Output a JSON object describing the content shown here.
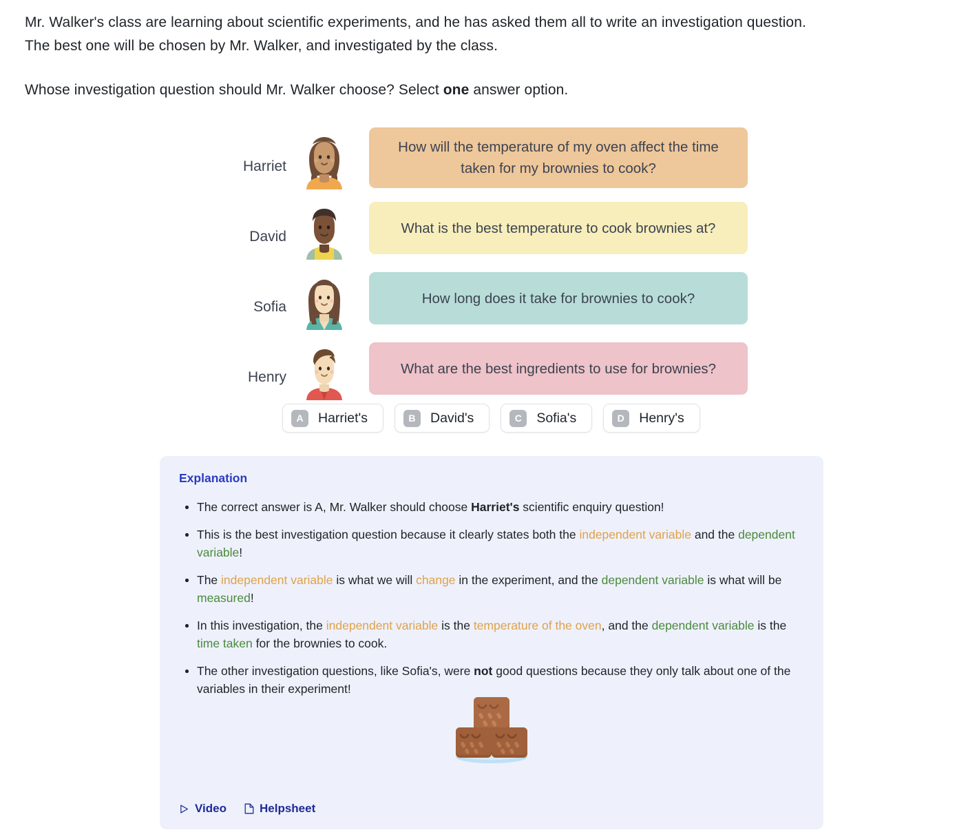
{
  "prompt": {
    "line1": "Mr. Walker's class are learning about scientific experiments, and he has asked them all to write an investigation question.",
    "line2": "The best one will be chosen by Mr. Walker, and investigated by the class.",
    "line3_before": "Whose investigation question should Mr. Walker choose? Select ",
    "line3_bold": "one",
    "line3_after": " answer option."
  },
  "students": [
    {
      "name": "Harriet",
      "question": "How will the temperature of my oven affect the time taken for my brownies to cook?",
      "bubble_color": "#eec79a",
      "avatar": "harriet-avatar"
    },
    {
      "name": "David",
      "question": "What is the best temperature to cook brownies at?",
      "bubble_color": "#f8eebc",
      "avatar": "david-avatar"
    },
    {
      "name": "Sofia",
      "question": "How long does it take for brownies to cook?",
      "bubble_color": "#b8ddd8",
      "avatar": "sofia-avatar"
    },
    {
      "name": "Henry",
      "question": "What are the best ingredients to use for brownies?",
      "bubble_color": "#eec3c9",
      "avatar": "henry-avatar"
    }
  ],
  "options": [
    {
      "letter": "A",
      "label": "Harriet's"
    },
    {
      "letter": "B",
      "label": "David's"
    },
    {
      "letter": "C",
      "label": "Sofia's"
    },
    {
      "letter": "D",
      "label": "Henry's"
    }
  ],
  "explanation": {
    "title": "Explanation",
    "bullets": [
      {
        "parts": [
          {
            "t": "The correct answer is A, Mr. Walker should choose ",
            "s": "plain"
          },
          {
            "t": "Harriet's",
            "s": "bold"
          },
          {
            "t": " scientific enquiry question!",
            "s": "plain"
          }
        ]
      },
      {
        "parts": [
          {
            "t": "This is the best investigation question because it clearly states both the ",
            "s": "plain"
          },
          {
            "t": "independent variable",
            "s": "iv"
          },
          {
            "t": " and the ",
            "s": "plain"
          },
          {
            "t": "dependent variable",
            "s": "dv"
          },
          {
            "t": "!",
            "s": "plain"
          }
        ]
      },
      {
        "parts": [
          {
            "t": "The ",
            "s": "plain"
          },
          {
            "t": "independent variable",
            "s": "iv"
          },
          {
            "t": " is what we will ",
            "s": "plain"
          },
          {
            "t": "change",
            "s": "iv"
          },
          {
            "t": " in the experiment, and the ",
            "s": "plain"
          },
          {
            "t": "dependent variable",
            "s": "dv"
          },
          {
            "t": " is what will be ",
            "s": "plain"
          },
          {
            "t": "measured",
            "s": "dv"
          },
          {
            "t": "!",
            "s": "plain"
          }
        ]
      },
      {
        "parts": [
          {
            "t": "In this investigation, the ",
            "s": "plain"
          },
          {
            "t": "independent variable",
            "s": "iv"
          },
          {
            "t": " is the ",
            "s": "plain"
          },
          {
            "t": "temperature of the oven",
            "s": "iv"
          },
          {
            "t": ", and the ",
            "s": "plain"
          },
          {
            "t": "dependent variable",
            "s": "dv"
          },
          {
            "t": " is the ",
            "s": "plain"
          },
          {
            "t": "time taken",
            "s": "dv"
          },
          {
            "t": " for the brownies to cook.",
            "s": "plain"
          }
        ]
      },
      {
        "parts": [
          {
            "t": "The other investigation questions, like Sofia's, were ",
            "s": "plain"
          },
          {
            "t": "not",
            "s": "bold"
          },
          {
            "t": " good questions because they only talk about one of the variables in their experiment!",
            "s": "plain"
          }
        ]
      }
    ],
    "illustration": "brownie-stack-illustration",
    "links": [
      {
        "label": "Video",
        "icon": "play-icon"
      },
      {
        "label": "Helpsheet",
        "icon": "document-icon"
      }
    ]
  },
  "colors": {
    "independent_variable": "#e0a14a",
    "dependent_variable": "#4a8a3d",
    "explanation_title": "#2b3bbf",
    "explanation_bg": "#eef1fb",
    "link": "#1e2a96"
  }
}
